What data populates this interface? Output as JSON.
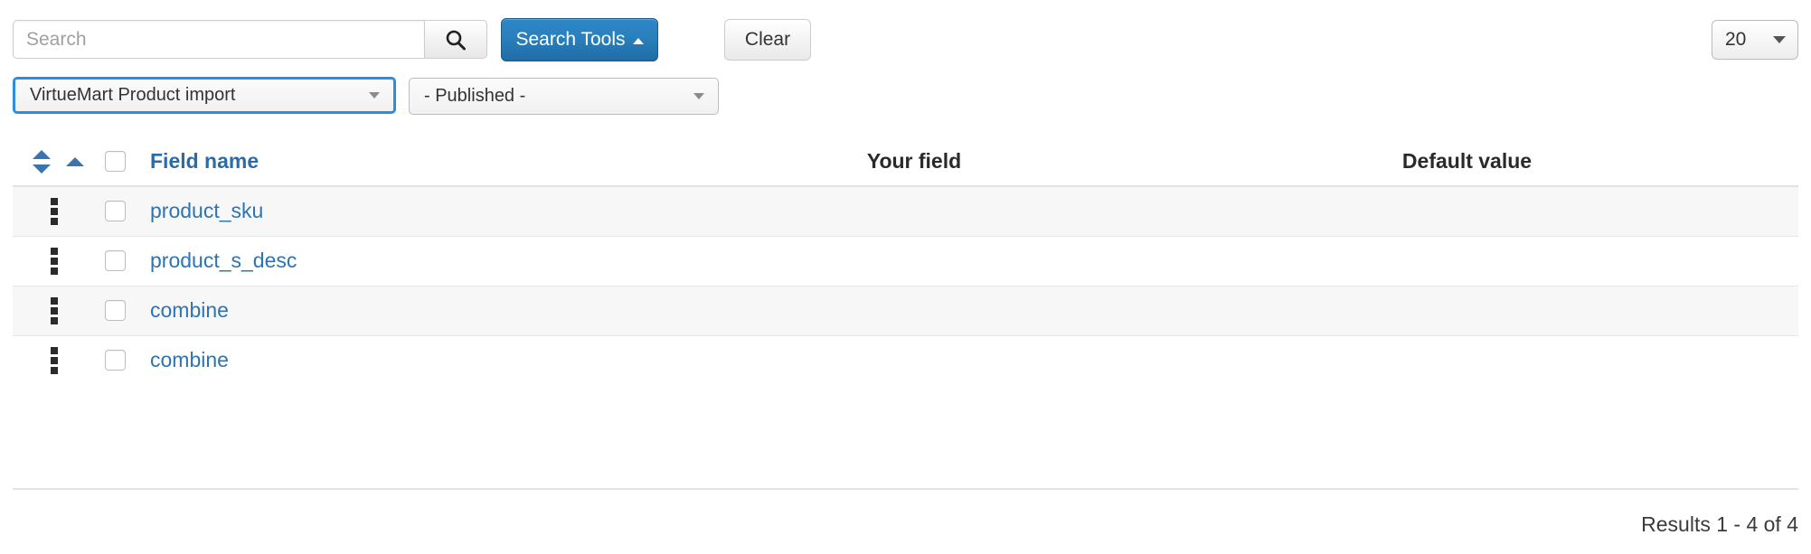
{
  "toolbar": {
    "search_placeholder": "Search",
    "search_value": "",
    "search_icon": "search-icon",
    "search_tools_label": "Search Tools",
    "search_tools_caret": "caret-up-icon",
    "clear_label": "Clear",
    "limit_value": "20",
    "limit_caret": "caret-down-icon"
  },
  "filters": {
    "type": {
      "selected": "VirtueMart Product import",
      "caret": "caret-down-icon"
    },
    "state": {
      "selected": "- Published -",
      "caret": "caret-down-icon"
    }
  },
  "table": {
    "sort_icons": {
      "ordering": "sort-updown-icon",
      "ascending": "sort-ascending-icon"
    },
    "select_all_checked": false,
    "columns": {
      "field_name": "Field name",
      "your_field": "Your field",
      "default_value": "Default value"
    },
    "rows": [
      {
        "drag": "drag-handle-icon",
        "checked": false,
        "field_name": "product_sku",
        "your_field": "",
        "default_value": ""
      },
      {
        "drag": "drag-handle-icon",
        "checked": false,
        "field_name": "product_s_desc",
        "your_field": "",
        "default_value": ""
      },
      {
        "drag": "drag-handle-icon",
        "checked": false,
        "field_name": "combine",
        "your_field": "",
        "default_value": ""
      },
      {
        "drag": "drag-handle-icon",
        "checked": false,
        "field_name": "combine",
        "your_field": "",
        "default_value": ""
      }
    ]
  },
  "footer": {
    "results_text": "Results 1 - 4 of 4"
  },
  "colors": {
    "link_blue": "#2d74b5",
    "primary_button": "#2980bb",
    "focus_border": "#2b8fe0",
    "row_stripe": "#f7f7f7"
  }
}
